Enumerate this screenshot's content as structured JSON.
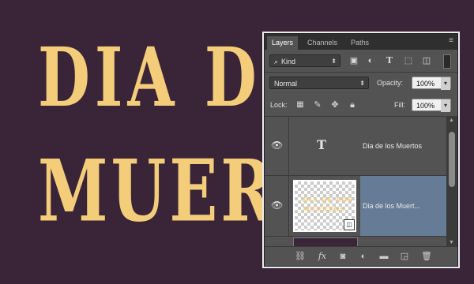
{
  "canvas": {
    "line1": "DIA DE",
    "line2": "MUER"
  },
  "panel": {
    "tabs": [
      {
        "label": "Layers",
        "active": true
      },
      {
        "label": "Channels",
        "active": false
      },
      {
        "label": "Paths",
        "active": false
      }
    ],
    "filter": {
      "value": "Kind",
      "icons": [
        "image-filter-icon",
        "adjustment-filter-icon",
        "type-filter-icon",
        "shape-filter-icon",
        "smart-object-filter-icon"
      ]
    },
    "blend_mode": "Normal",
    "opacity_label": "Opacity:",
    "opacity_value": "100%",
    "lock_label": "Lock:",
    "fill_label": "Fill:",
    "fill_value": "100%",
    "layers": [
      {
        "name": "Dia de los Muertos",
        "type": "text",
        "selected": false
      },
      {
        "name": "Dia de los Muert...",
        "type": "smart-object",
        "selected": true,
        "thumb_line1": "DIA DE LOS",
        "thumb_line2": "MUERTOS"
      }
    ],
    "footer_icons": [
      "link-layers-icon",
      "fx-icon",
      "mask-icon",
      "adjustment-icon",
      "group-folder-icon",
      "new-layer-icon",
      "delete-icon"
    ]
  },
  "colors": {
    "background": "#3a2438",
    "text_fill": "#f3cd7a",
    "selected_layer": "#667c96"
  }
}
